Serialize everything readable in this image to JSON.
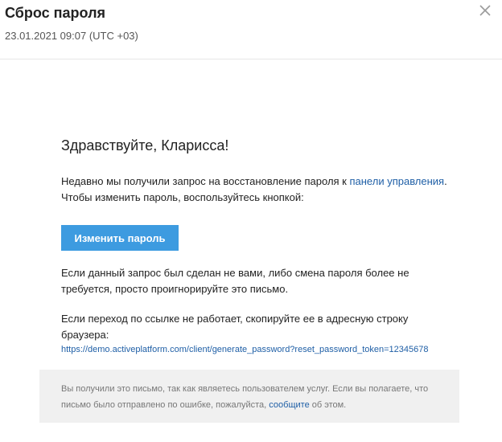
{
  "header": {
    "title": "Сброс пароля",
    "timestamp": "23.01.2021 09:07 (UTC +03)",
    "close_icon": "close-icon"
  },
  "email": {
    "greeting": "Здравствуйте, Кларисса!",
    "p1_before_link": "Недавно мы получили запрос на восстановление пароля к ",
    "p1_link": "панели управления",
    "p1_after_link": ". Чтобы изменить пароль, воспользуйтесь кнопкой:",
    "button_label": "Изменить пароль",
    "p2": "Если данный запрос был сделан не вами, либо смена пароля более не требуется, просто проигнорируйте это письмо.",
    "p3": "Если переход по ссылке не работает, скопируйте ее в адресную строку браузера:",
    "reset_url": "https://demo.activeplatform.com/client/generate_password?reset_password_token=12345678"
  },
  "footer": {
    "text_before_link": "Вы получили это письмо, так как являетесь пользователем услуг. Если вы полагаете, что письмо было отправлено по ошибке, пожалуйста, ",
    "link": "сообщите",
    "text_after_link": " об этом."
  },
  "colors": {
    "button_bg": "#3d9be0",
    "link": "#1f5fa6",
    "footer_bg": "#f0f0f0"
  }
}
